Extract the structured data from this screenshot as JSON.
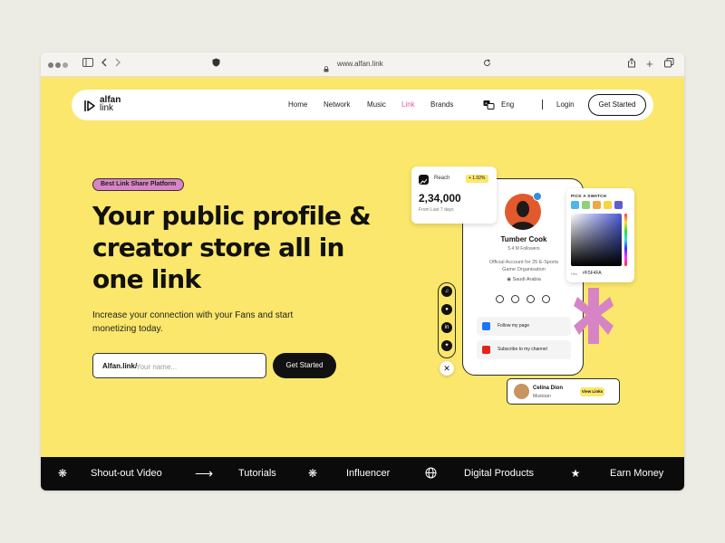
{
  "browser": {
    "url": "www.alfan.link"
  },
  "logo": {
    "line1": "alfan",
    "line2": "link"
  },
  "nav": {
    "links": [
      "Home",
      "Network",
      "Music",
      "Link",
      "Brands"
    ],
    "active": "Link",
    "lang": "Eng",
    "login": "Login",
    "cta": "Get Started"
  },
  "hero": {
    "badge": "Best Link Share Platform",
    "headline": "Your public profile & creator store all in one link",
    "subtext": "Increase your connection with your Fans and start monetizing today.",
    "input_prefix": "Alfan.link/",
    "input_placeholder": "Your name...",
    "cta": "Get Started"
  },
  "reach_card": {
    "label": "Reach",
    "change": "+ 1.02%",
    "value": "2,34,000",
    "sub": "From Last 7 days"
  },
  "profile": {
    "name": "Tumber Cook",
    "followers": "5.4 M Followers",
    "bio": "Official Account for 25 E-Sports Game Organisation",
    "location": "Saudi Arabia",
    "links": [
      {
        "label": "Follow my page",
        "icon": "facebook-icon"
      },
      {
        "label": "Subscribe to my channel",
        "icon": "youtube-icon"
      }
    ],
    "side_socials": [
      "tiktok-icon",
      "snapchat-icon",
      "linkedin-icon",
      "twitter-icon"
    ]
  },
  "swatch": {
    "title": "PICK A SWATCH",
    "hex_label": "Hex",
    "hex": "#F5F4FA",
    "chips": [
      "#4fb6e8",
      "#8dd17a",
      "#f0a64a",
      "#f6d441",
      "#5d5fcf"
    ]
  },
  "creator_card": {
    "name": "Celina Dion",
    "role": "Musician",
    "button": "View Links"
  },
  "ticker": {
    "items": [
      "Shout-out Video",
      "Tutorials",
      "Influencer",
      "Digital Products",
      "Earn Money"
    ]
  },
  "colors": {
    "background": "#fbe76b",
    "accent_pink": "#e25c9a",
    "badge": "#d784c6",
    "dark": "#0b0b0b"
  }
}
